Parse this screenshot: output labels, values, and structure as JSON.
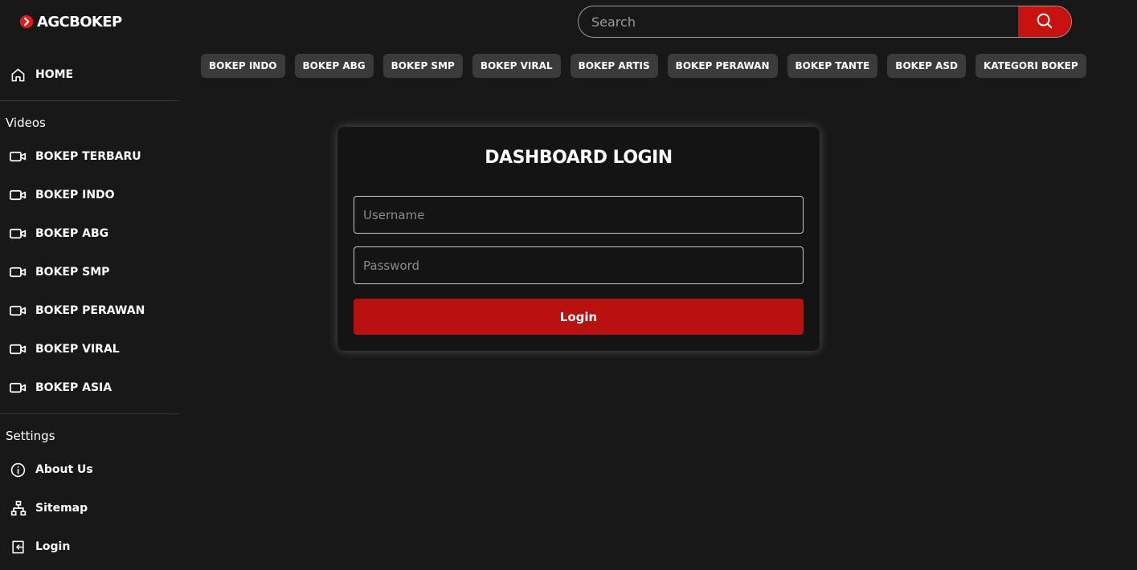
{
  "brand": {
    "name": "AGCBOKEP",
    "accent": "#c8120f"
  },
  "search": {
    "placeholder": "Search",
    "value": "",
    "icon": "search-icon"
  },
  "sidebar": {
    "home": {
      "label": "HOME",
      "icon": "home-icon"
    },
    "videos_title": "Videos",
    "videos": [
      {
        "label": "BOKEP TERBARU",
        "icon": "video-camera-icon"
      },
      {
        "label": "BOKEP INDO",
        "icon": "video-camera-icon"
      },
      {
        "label": "BOKEP ABG",
        "icon": "video-camera-icon"
      },
      {
        "label": "BOKEP SMP",
        "icon": "video-camera-icon"
      },
      {
        "label": "BOKEP PERAWAN",
        "icon": "video-camera-icon"
      },
      {
        "label": "BOKEP VIRAL",
        "icon": "video-camera-icon"
      },
      {
        "label": "BOKEP ASIA",
        "icon": "video-camera-icon"
      }
    ],
    "settings_title": "Settings",
    "settings": [
      {
        "label": "About Us",
        "icon": "info-icon"
      },
      {
        "label": "Sitemap",
        "icon": "sitemap-icon"
      },
      {
        "label": "Login",
        "icon": "login-icon"
      }
    ]
  },
  "categories": [
    "BOKEP INDO",
    "BOKEP ABG",
    "BOKEP SMP",
    "BOKEP VIRAL",
    "BOKEP ARTIS",
    "BOKEP PERAWAN",
    "BOKEP TANTE",
    "BOKEP ASD",
    "KATEGORI BOKEP"
  ],
  "login": {
    "title": "DASHBOARD LOGIN",
    "username_placeholder": "Username",
    "password_placeholder": "Password",
    "button_label": "Login",
    "button_color": "#b91010"
  }
}
